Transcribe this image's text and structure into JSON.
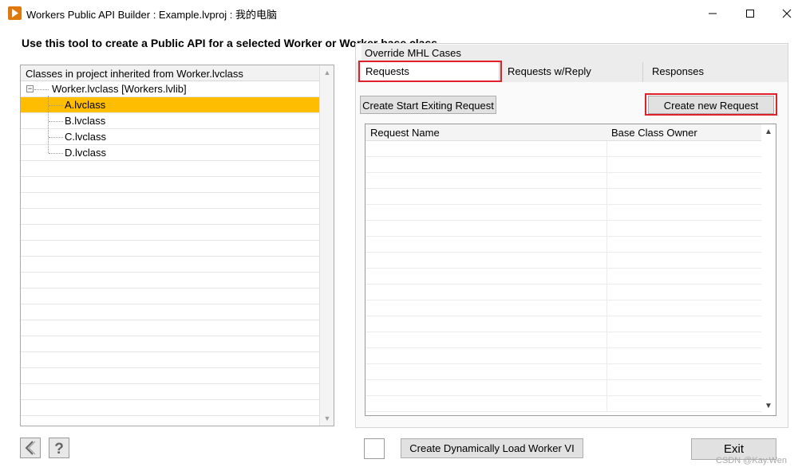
{
  "window": {
    "title": "Workers Public API Builder : Example.lvproj : 我的电脑",
    "app_icon": "labview-run-icon",
    "min_icon": "minimize-icon",
    "max_icon": "maximize-icon",
    "close_icon": "close-icon"
  },
  "heading": "Use this tool to create a Public API for a selected Worker or Worker base class",
  "class_tree": {
    "header": "Classes in project inherited from Worker.lvclass",
    "root": "Worker.lvclass  [Workers.lvlib]",
    "expander_glyph": "−",
    "children": [
      "A.lvclass",
      "B.lvclass",
      "C.lvclass",
      "D.lvclass"
    ],
    "selected": "A.lvclass",
    "selected_color": "#ffbd00"
  },
  "tabs": {
    "override": "Override MHL Cases",
    "items": [
      "Requests",
      "Requests w/Reply",
      "Responses"
    ],
    "active": "Requests"
  },
  "buttons": {
    "create_start_exiting": "Create Start Exiting Request",
    "create_new_request": "Create new Request",
    "create_dynamic": "Create Dynamically Load Worker VI",
    "exit": "Exit"
  },
  "request_table": {
    "columns": [
      "Request Name",
      "Base Class Owner"
    ],
    "rows": []
  },
  "bottom": {
    "back_icon": "back-arrow-icon",
    "help_icon": "help-question-icon"
  },
  "highlight_color": "#e0202a",
  "watermark": "CSDN @Kay.Wen"
}
